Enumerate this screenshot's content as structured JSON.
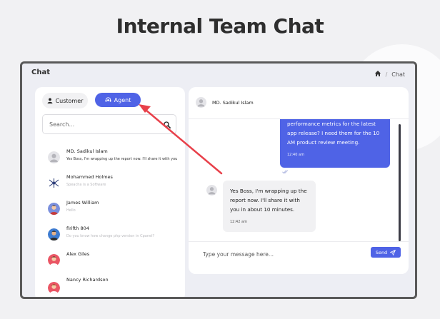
{
  "headline": "Internal Team Chat",
  "app": {
    "title": "Chat",
    "breadcrumb": {
      "current": "Chat"
    }
  },
  "tabs": {
    "customer": "Customer",
    "agent": "Agent"
  },
  "search": {
    "placeholder": "Search..."
  },
  "contacts": [
    {
      "name": "MD. Sadikul Islam",
      "preview": "Yes Boss, I'm wrapping up the report now. I'll share it with you",
      "active": true,
      "avatar": "default-avatar"
    },
    {
      "name": "Mohammed Holmes",
      "preview": "Speacha is a Software",
      "active": false,
      "avatar": "logo-avatar"
    },
    {
      "name": "James William",
      "preview": "Hello",
      "active": false,
      "avatar": "person-avatar"
    },
    {
      "name": "firifth 804",
      "preview": "Do you know how change php version in Cpanel?",
      "active": false,
      "avatar": "person-avatar"
    },
    {
      "name": "Alex Giles",
      "preview": "",
      "active": false,
      "avatar": "person-avatar"
    },
    {
      "name": "Nancy Richardson",
      "preview": "",
      "active": false,
      "avatar": "person-avatar"
    }
  ],
  "chat": {
    "contact_name": "MD. Sadikul Islam",
    "messages": [
      {
        "direction": "out",
        "text": "performance metrics for the latest app release? I need them for the 10 AM product review meeting.",
        "time": "12:40 am"
      },
      {
        "direction": "in",
        "text": "Yes Boss, I'm wrapping up the report now. I'll share it with you in about 10 minutes.",
        "time": "12:42 am"
      }
    ]
  },
  "composer": {
    "placeholder": "Type your message here...",
    "send_label": "Send"
  },
  "colors": {
    "accent": "#4f63e6",
    "arrow": "#e8404a"
  }
}
